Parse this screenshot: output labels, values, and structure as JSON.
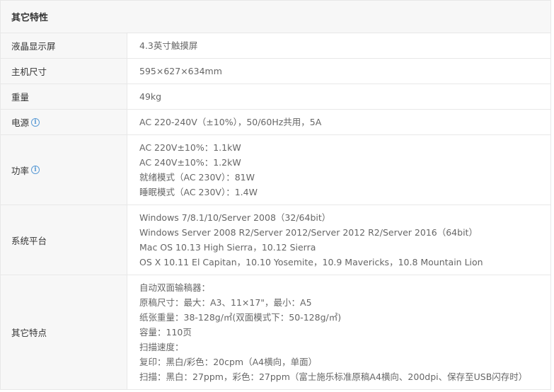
{
  "section": {
    "title": "其它特性"
  },
  "rows": [
    {
      "label": "液晶显示屏",
      "values": [
        "4.3英寸触摸屏"
      ]
    },
    {
      "label": "主机尺寸",
      "values": [
        "595×627×634mm"
      ]
    },
    {
      "label": "重量",
      "values": [
        "49kg"
      ]
    },
    {
      "label": "电源",
      "info_icon": "info-icon",
      "values": [
        "AC 220-240V（±10%），50/60Hz共用，5A"
      ]
    },
    {
      "label": "功率",
      "info_icon": "info-icon",
      "values": [
        "AC 220V±10%：1.1kW",
        "AC 240V±10%：1.2kW",
        "就绪模式（AC 230V）：81W",
        "睡眠模式（AC 230V）：1.4W"
      ]
    },
    {
      "label": "系统平台",
      "values": [
        "Windows 7/8.1/10/Server 2008（32/64bit）",
        "Windows Server 2008 R2/Server 2012/Server 2012 R2/Server 2016（64bit）",
        "Mac OS 10.13 High Sierra，10.12 Sierra",
        "OS X 10.11 El Capitan，10.10 Yosemite，10.9 Mavericks，10.8 Mountain Lion"
      ]
    },
    {
      "label": "其它特点",
      "values": [
        "自动双面输稿器：",
        "原稿尺寸：最大：A3、11×17\"，最小：A5",
        "纸张重量：38-128g/㎡(双面模式下：50-128g/㎡)",
        "容量：110页",
        "扫描速度：",
        "复印：黑白/彩色：20cpm（A4横向，单面）",
        "扫描：黑白：27ppm，彩色：27ppm（富士施乐标准原稿A4横向、200dpi、保存至USB闪存时）"
      ]
    }
  ],
  "colors": {
    "label_bg": "#f7f7f7",
    "border": "#e8e8e8",
    "label_text": "#333333",
    "value_text": "#666666",
    "info_icon": "#5b9bd5"
  }
}
